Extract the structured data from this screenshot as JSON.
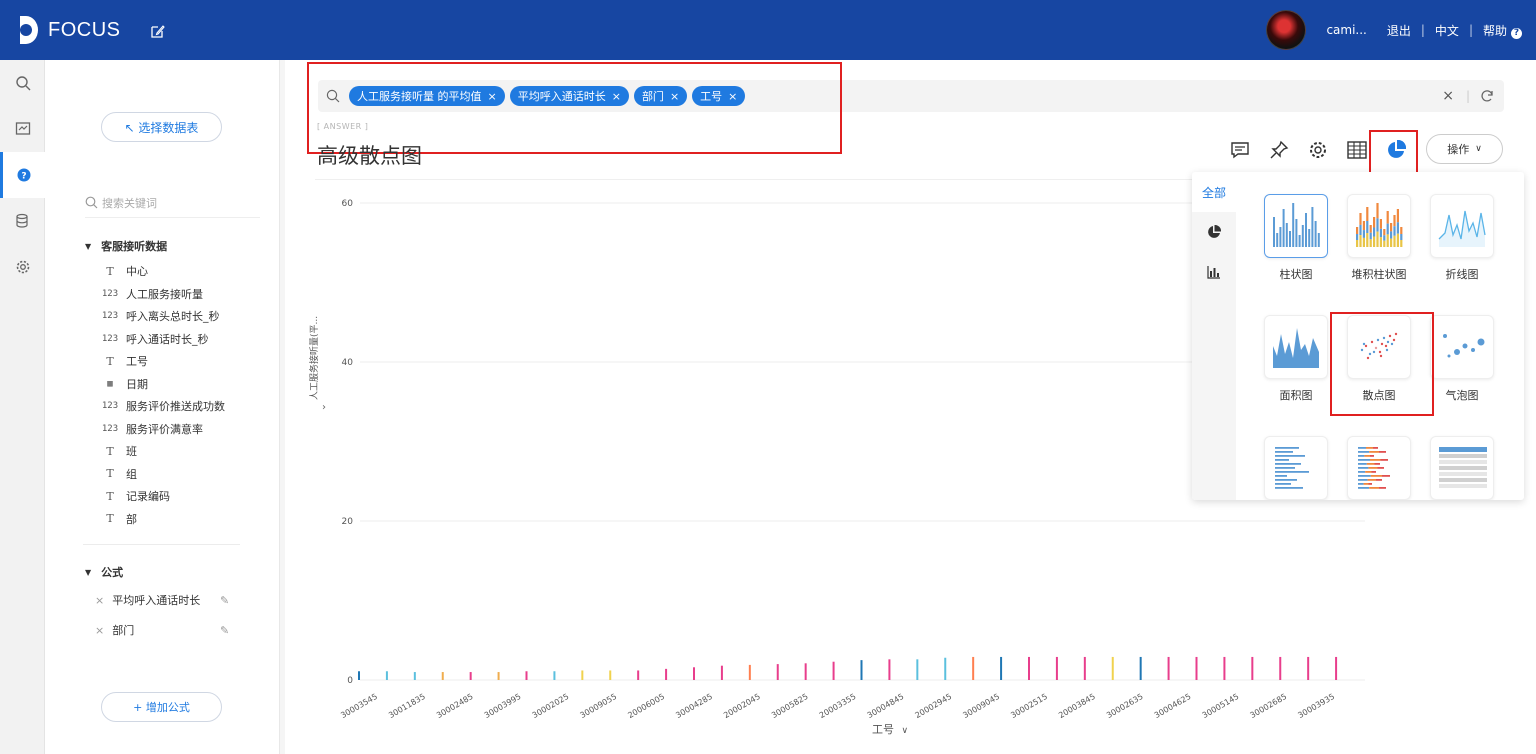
{
  "header": {
    "logo_text": "FOCUS",
    "user_name": "cami...",
    "logout": "退出",
    "language": "中文",
    "help": "帮助",
    "help_mark": "?"
  },
  "rail": {
    "items": [
      {
        "icon": "search-icon"
      },
      {
        "icon": "dashboard-icon"
      },
      {
        "icon": "question-icon"
      },
      {
        "icon": "database-icon"
      },
      {
        "icon": "gear-icon"
      }
    ]
  },
  "panel": {
    "select_table": "↖ 选择数据表",
    "search_placeholder": "搜索关键词",
    "group_title": "客服接听数据",
    "fields": [
      {
        "type": "text",
        "label": "中心"
      },
      {
        "type": "number",
        "label": "人工服务接听量"
      },
      {
        "type": "number",
        "label": "呼入离头总时长_秒"
      },
      {
        "type": "number",
        "label": "呼入通话时长_秒"
      },
      {
        "type": "text",
        "label": "工号"
      },
      {
        "type": "date",
        "label": "日期"
      },
      {
        "type": "number",
        "label": "服务评价推送成功数"
      },
      {
        "type": "number",
        "label": "服务评价满意率"
      },
      {
        "type": "text",
        "label": "班"
      },
      {
        "type": "text",
        "label": "组"
      },
      {
        "type": "text",
        "label": "记录编码"
      },
      {
        "type": "text",
        "label": "部"
      }
    ],
    "formula_title": "公式",
    "formulas": [
      "平均呼入通话时长",
      "部门"
    ],
    "add_formula": "+ 增加公式"
  },
  "search": {
    "chips": [
      "人工服务接听量  的平均值",
      "平均呼入通话时长",
      "部门",
      "工号"
    ],
    "chip_close": "×",
    "clear": "×"
  },
  "answer": {
    "label": "[ ANSWER ]",
    "title": "高级散点图",
    "ops_button": "操作"
  },
  "chart_data": {
    "type": "bar",
    "ylabel": "人工服务接听量(平...",
    "xlabel": "工号",
    "ylim": [
      0,
      60
    ],
    "yticks": [
      0,
      20,
      40,
      60
    ],
    "x_tick_labels": [
      "30003545",
      "30011835",
      "30002485",
      "30003995",
      "30002025",
      "30009055",
      "20006005",
      "30004285",
      "20002045",
      "30005825",
      "20003355",
      "30004845",
      "20002945",
      "30009045",
      "30002515",
      "20003845",
      "30002635",
      "30004625",
      "30005145",
      "30002685",
      "30003935"
    ],
    "values": [
      1.1,
      1.0,
      1.1,
      1.0,
      1.0,
      1.0,
      1.0,
      1.0,
      1.1,
      1.0,
      1.0,
      1.0,
      1.0,
      1.1,
      1.0,
      1.1,
      1.1,
      1.1,
      1.2,
      1.2,
      1.2,
      1.3,
      1.2,
      1.3,
      1.4,
      1.4,
      1.5,
      1.6,
      1.7,
      1.8,
      1.9,
      1.9,
      1.9,
      2.0,
      2.0,
      2.1,
      2.1,
      2.2,
      2.3,
      2.3,
      2.4,
      2.5,
      2.5,
      2.6,
      2.6,
      2.6,
      2.7,
      2.8,
      2.8,
      2.8,
      2.9,
      2.9,
      2.9,
      2.9,
      2.9,
      2.9,
      2.9,
      3.0,
      2.9,
      2.9,
      2.9,
      2.9,
      3.0,
      2.9,
      2.9,
      2.9,
      2.9,
      2.9,
      2.9,
      2.9,
      2.9,
      2.9,
      2.9,
      2.9,
      2.9,
      2.9,
      2.9,
      2.9,
      2.9,
      2.9,
      2.9,
      3.0
    ],
    "colors": [
      "#1f77b4",
      "#5bc0de",
      "#5bc0de",
      "#f0ad4e",
      "#e83e8c",
      "#f0ad4e",
      "#e83e8c",
      "#5bc0de",
      "#f0d24e",
      "#f0d24e",
      "#e83e8c",
      "#e83e8c",
      "#e83e8c",
      "#e83e8c",
      "#ff7f50",
      "#e83e8c",
      "#e83e8c",
      "#e83e8c",
      "#1f77b4",
      "#e83e8c",
      "#5bc0de",
      "#5bc0de",
      "#ff7f50",
      "#1f77b4",
      "#e83e8c",
      "#e83e8c",
      "#e83e8c",
      "#f0d24e",
      "#1f77b4",
      "#e83e8c",
      "#e83e8c",
      "#e83e8c",
      "#e83e8c",
      "#e83e8c",
      "#e83e8c",
      "#e83e8c"
    ]
  },
  "chart_types": {
    "tab_all": "全部",
    "items": [
      {
        "label": "柱状图",
        "kind": "bar"
      },
      {
        "label": "堆积柱状图",
        "kind": "stacked"
      },
      {
        "label": "折线图",
        "kind": "line"
      },
      {
        "label": "面积图",
        "kind": "area"
      },
      {
        "label": "散点图",
        "kind": "scatter"
      },
      {
        "label": "气泡图",
        "kind": "bubble"
      },
      {
        "label": "",
        "kind": "hbar"
      },
      {
        "label": "",
        "kind": "hstacked"
      },
      {
        "label": "",
        "kind": "table"
      }
    ]
  }
}
